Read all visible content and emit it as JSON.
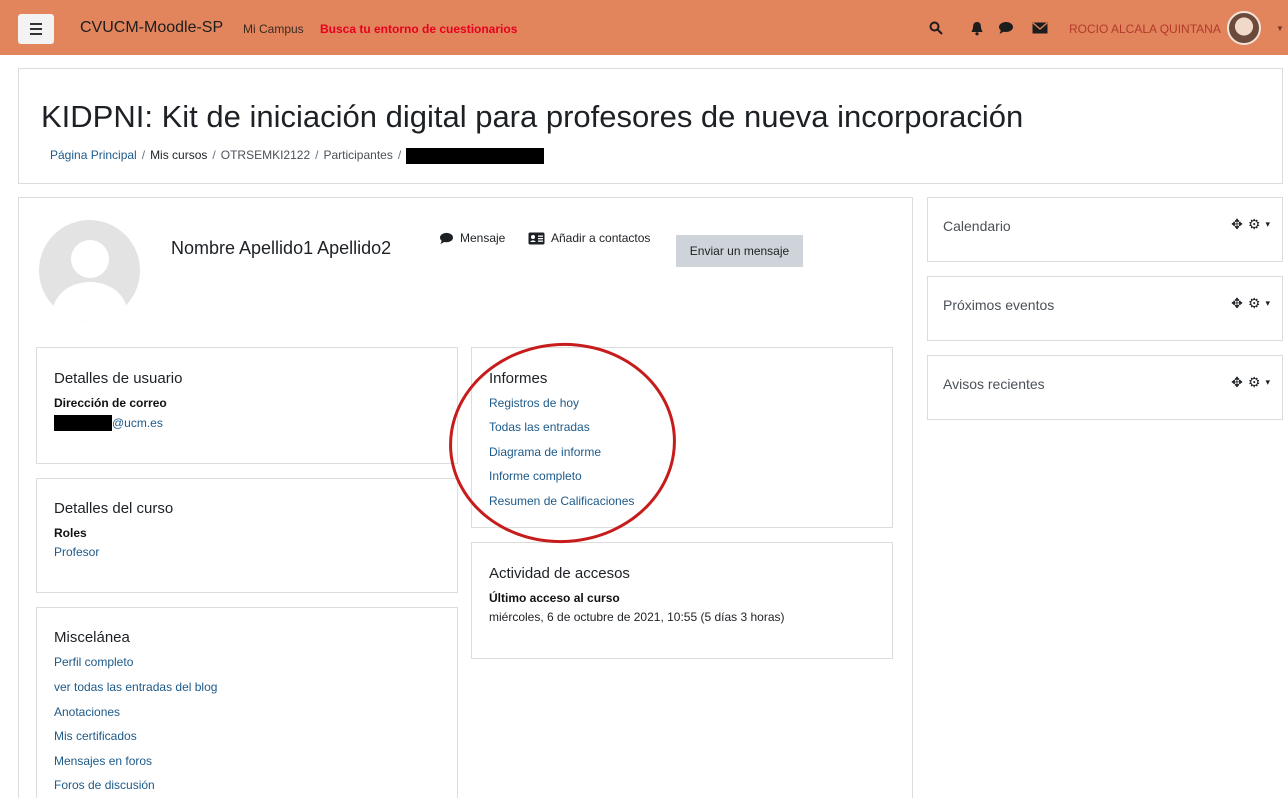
{
  "navbar": {
    "site_name": "CVUCM-Moodle-SP",
    "mi_campus": "Mi Campus",
    "quiz_link": "Busca tu entorno de cuestionarios",
    "user_name": "ROCIO ALCALA QUINTANA",
    "bg_color": "#e2855d"
  },
  "header": {
    "title": "KIDPNI: Kit de iniciación digital para profesores de nueva incorporación",
    "breadcrumb": [
      "Página Principal",
      "Mis cursos",
      "OTRSEMKI2122",
      "Participantes"
    ]
  },
  "profile": {
    "fullname": "Nombre Apellido1 Apellido2",
    "message_label": "Mensaje",
    "add_contacts_label": "Añadir a contactos",
    "send_message_button": "Enviar un mensaje"
  },
  "user_details": {
    "title": "Detalles de usuario",
    "email_label": "Dirección de correo",
    "email_suffix": "@ucm.es"
  },
  "course_details": {
    "title": "Detalles del curso",
    "roles_label": "Roles",
    "role": "Profesor"
  },
  "misc": {
    "title": "Miscelánea",
    "links": [
      "Perfil completo",
      "ver todas las entradas del blog",
      "Anotaciones",
      "Mis certificados",
      "Mensajes en foros",
      "Foros de discusión"
    ]
  },
  "reports": {
    "title": "Informes",
    "links": [
      "Registros de hoy",
      "Todas las entradas",
      "Diagrama de informe",
      "Informe completo",
      "Resumen de Calificaciones"
    ]
  },
  "access": {
    "title": "Actividad de accesos",
    "last_access_label": "Último acceso al curso",
    "last_access_value": "miércoles, 6 de octubre de 2021, 10:55  (5 días 3 horas)"
  },
  "blocks": [
    "Calendario",
    "Próximos eventos",
    "Avisos recientes"
  ],
  "colors": {
    "link": "#1d5a8a",
    "annotation": "#c71c1c"
  }
}
